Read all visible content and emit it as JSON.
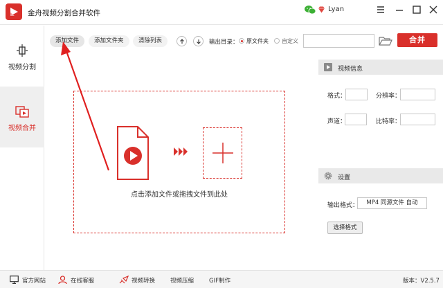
{
  "app": {
    "title": "金舟视频分割合并软件",
    "user_name": "Lyan"
  },
  "sidebar": {
    "items": [
      {
        "label": "视频分割",
        "active": false
      },
      {
        "label": "视频合并",
        "active": true
      }
    ]
  },
  "toolbar": {
    "add_file": "添加文件",
    "add_folder": "添加文件夹",
    "clear_list": "清除列表",
    "output_dir_label": "输出目录：",
    "source_folder": "原文件夹",
    "custom": "自定义",
    "output_path": "",
    "merge": "合并"
  },
  "dropzone": {
    "hint": "点击添加文件或拖拽文件到此处"
  },
  "video_info": {
    "title": "视频信息",
    "format_label": "格式：",
    "format_value": "",
    "resolution_label": "分辨率：",
    "resolution_value": "",
    "channel_label": "声道：",
    "channel_value": "",
    "bitrate_label": "比特率：",
    "bitrate_value": ""
  },
  "settings": {
    "title": "设置",
    "output_format_label": "输出格式：",
    "output_format_value": "MP4 同源文件 自动",
    "choose_format": "选择格式"
  },
  "footer": {
    "site": "官方网站",
    "service": "在线客服",
    "convert": "视频转换",
    "compress": "视频压缩",
    "gif": "GIF制作",
    "version": "版本：V2.5.7"
  },
  "colors": {
    "accent": "#d9302b",
    "active_bg": "#efefef",
    "panel_header": "#e9e9e9"
  }
}
